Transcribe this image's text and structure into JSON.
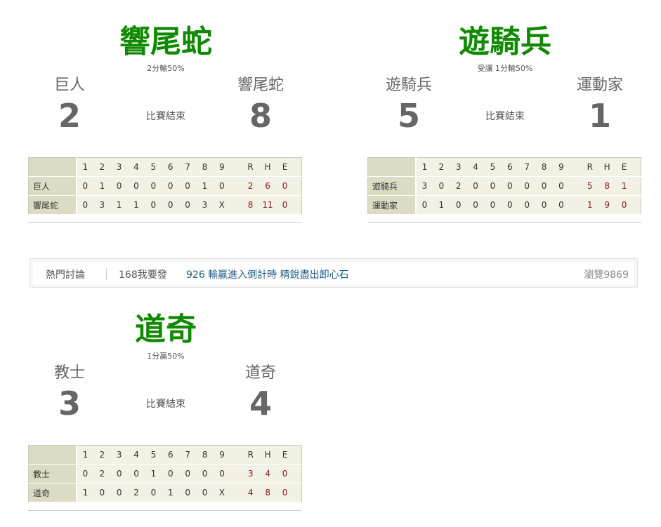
{
  "games": [
    {
      "winner": "響尾蛇",
      "note": "2分輸50%",
      "away_team": "巨人",
      "home_team": "響尾蛇",
      "away_score": "2",
      "home_score": "8",
      "status": "比賽結束",
      "header": [
        "1",
        "2",
        "3",
        "4",
        "5",
        "6",
        "7",
        "8",
        "9",
        "R",
        "H",
        "E"
      ],
      "rows": [
        {
          "team": "巨人",
          "innings": [
            "0",
            "1",
            "0",
            "0",
            "0",
            "0",
            "0",
            "1",
            "0"
          ],
          "rhe": [
            "2",
            "6",
            "0"
          ]
        },
        {
          "team": "響尾蛇",
          "innings": [
            "0",
            "3",
            "1",
            "1",
            "0",
            "0",
            "0",
            "3",
            "X"
          ],
          "rhe": [
            "8",
            "11",
            "0"
          ]
        }
      ]
    },
    {
      "winner": "遊騎兵",
      "note": "受讓 1分輸50%",
      "away_team": "遊騎兵",
      "home_team": "運動家",
      "away_score": "5",
      "home_score": "1",
      "status": "比賽結束",
      "header": [
        "1",
        "2",
        "3",
        "4",
        "5",
        "6",
        "7",
        "8",
        "9",
        "R",
        "H",
        "E"
      ],
      "rows": [
        {
          "team": "遊騎兵",
          "innings": [
            "3",
            "0",
            "2",
            "0",
            "0",
            "0",
            "0",
            "0",
            "0"
          ],
          "rhe": [
            "5",
            "8",
            "1"
          ]
        },
        {
          "team": "運動家",
          "innings": [
            "0",
            "1",
            "0",
            "0",
            "0",
            "0",
            "0",
            "0",
            "0"
          ],
          "rhe": [
            "1",
            "9",
            "0"
          ]
        }
      ]
    },
    {
      "winner": "道奇",
      "note": "1分贏50%",
      "away_team": "教士",
      "home_team": "道奇",
      "away_score": "3",
      "home_score": "4",
      "status": "比賽結束",
      "header": [
        "1",
        "2",
        "3",
        "4",
        "5",
        "6",
        "7",
        "8",
        "9",
        "R",
        "H",
        "E"
      ],
      "rows": [
        {
          "team": "教士",
          "innings": [
            "0",
            "2",
            "0",
            "0",
            "1",
            "0",
            "0",
            "0",
            "0"
          ],
          "rhe": [
            "3",
            "4",
            "0"
          ]
        },
        {
          "team": "道奇",
          "innings": [
            "1",
            "0",
            "0",
            "2",
            "0",
            "1",
            "0",
            "0",
            "X"
          ],
          "rhe": [
            "4",
            "8",
            "0"
          ]
        }
      ]
    }
  ],
  "forum": {
    "label": "熱門討論",
    "author": "168我要發",
    "title": "926 輸贏進入倒計時 精銳盡出卸心石",
    "views": "瀏覽9869"
  }
}
